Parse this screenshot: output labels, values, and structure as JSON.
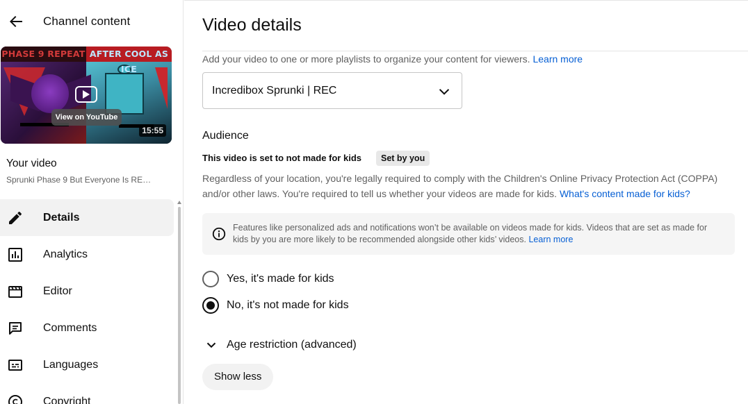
{
  "sidebar": {
    "title": "Channel content",
    "back_icon": "arrow-left-icon",
    "thumbnail": {
      "banner_left": "PHASE 9 REPEAT",
      "banner_right": "AFTER COOL AS ICE",
      "view_label": "View on YouTube",
      "duration": "15:55"
    },
    "your_video_label": "Your video",
    "video_title": "Sprunki Phase 9 But Everyone Is RE…",
    "nav": [
      {
        "label": "Details",
        "icon": "pencil-icon",
        "active": true
      },
      {
        "label": "Analytics",
        "icon": "analytics-icon"
      },
      {
        "label": "Editor",
        "icon": "clapperboard-icon"
      },
      {
        "label": "Comments",
        "icon": "comment-icon"
      },
      {
        "label": "Languages",
        "icon": "subtitles-icon"
      },
      {
        "label": "Copyright",
        "icon": "copyright-icon"
      }
    ]
  },
  "main": {
    "title": "Video details",
    "playlists": {
      "description": "Add your video to one or more playlists to organize your content for viewers.",
      "learn_more": "Learn more",
      "selected": "Incredibox Sprunki | REC"
    },
    "audience": {
      "heading": "Audience",
      "status": "This video is set to not made for kids",
      "badge": "Set by you",
      "coppa_text": "Regardless of your location, you're legally required to comply with the Children's Online Privacy Protection Act (COPPA) and/or other laws. You're required to tell us whether your videos are made for kids.",
      "coppa_link": "What's content made for kids?",
      "info_text": "Features like personalized ads and notifications won’t be available on videos made for kids. Videos that are set as made for kids by you are more likely to be recommended alongside other kids’ videos.",
      "info_link": "Learn more",
      "options": [
        {
          "label": "Yes, it's made for kids",
          "checked": false
        },
        {
          "label": "No, it's not made for kids",
          "checked": true
        }
      ]
    },
    "age_restriction": "Age restriction (advanced)",
    "show_less": "Show less"
  },
  "colors": {
    "link": "#065fd4",
    "text_primary": "#0f0f0f",
    "text_secondary": "#606060",
    "active_bg": "#f2f2f2"
  }
}
